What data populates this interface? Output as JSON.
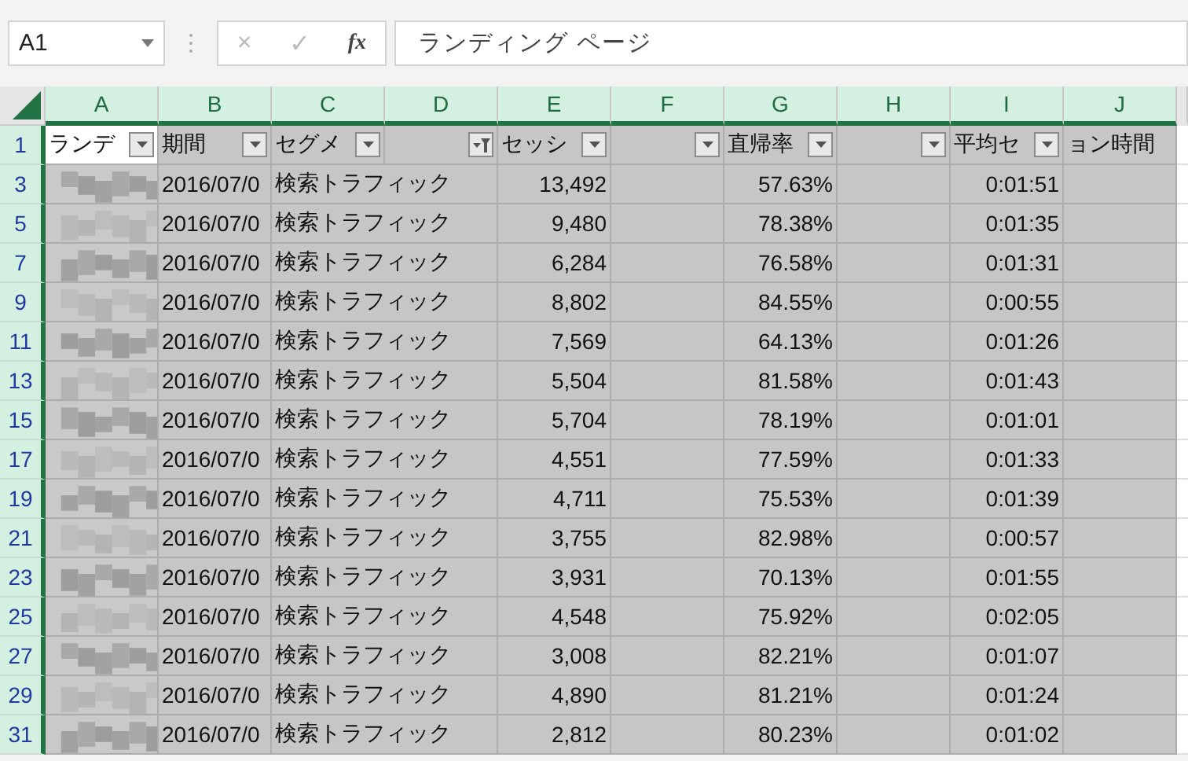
{
  "name_box": {
    "value": "A1"
  },
  "formula_bar": {
    "cancel": "×",
    "enter": "✓",
    "function": "fx",
    "value": "ランディング ページ"
  },
  "columns": [
    {
      "letter": "A",
      "selected": true
    },
    {
      "letter": "B",
      "selected": true
    },
    {
      "letter": "C",
      "selected": true
    },
    {
      "letter": "D",
      "selected": true
    },
    {
      "letter": "E",
      "selected": true
    },
    {
      "letter": "F",
      "selected": true
    },
    {
      "letter": "G",
      "selected": true
    },
    {
      "letter": "H",
      "selected": true
    },
    {
      "letter": "I",
      "selected": true
    },
    {
      "letter": "J",
      "selected": true
    }
  ],
  "header_row": {
    "number": "1",
    "cells": [
      {
        "text": "ランデ",
        "filter_button": true,
        "filter_applied": false
      },
      {
        "text": "期間",
        "filter_button": true,
        "filter_applied": false
      },
      {
        "text": "セグメ",
        "filter_button": true,
        "filter_applied": false
      },
      {
        "filter_button": true,
        "filter_applied": true
      },
      {
        "text": "セッシ",
        "filter_button": true,
        "filter_applied": false
      },
      {
        "filter_button": true,
        "filter_applied": false
      },
      {
        "text": "直帰率",
        "filter_button": true,
        "filter_applied": false
      },
      {
        "filter_button": true,
        "filter_applied": false
      },
      {
        "text": "平均セ",
        "filter_button": true,
        "filter_applied": false
      },
      {
        "text": "ョン時間",
        "filter_button": false
      }
    ]
  },
  "rows": [
    {
      "number": "3",
      "period": "2016/07/0",
      "segment": "検索トラフィック",
      "sessions": "13,492",
      "bounce_rate": "57.63%",
      "avg_duration": "0:01:51"
    },
    {
      "number": "5",
      "period": "2016/07/0",
      "segment": "検索トラフィック",
      "sessions": "9,480",
      "bounce_rate": "78.38%",
      "avg_duration": "0:01:35"
    },
    {
      "number": "7",
      "period": "2016/07/0",
      "segment": "検索トラフィック",
      "sessions": "6,284",
      "bounce_rate": "76.58%",
      "avg_duration": "0:01:31"
    },
    {
      "number": "9",
      "period": "2016/07/0",
      "segment": "検索トラフィック",
      "sessions": "8,802",
      "bounce_rate": "84.55%",
      "avg_duration": "0:00:55"
    },
    {
      "number": "11",
      "period": "2016/07/0",
      "segment": "検索トラフィック",
      "sessions": "7,569",
      "bounce_rate": "64.13%",
      "avg_duration": "0:01:26"
    },
    {
      "number": "13",
      "period": "2016/07/0",
      "segment": "検索トラフィック",
      "sessions": "5,504",
      "bounce_rate": "81.58%",
      "avg_duration": "0:01:43"
    },
    {
      "number": "15",
      "period": "2016/07/0",
      "segment": "検索トラフィック",
      "sessions": "5,704",
      "bounce_rate": "78.19%",
      "avg_duration": "0:01:01"
    },
    {
      "number": "17",
      "period": "2016/07/0",
      "segment": "検索トラフィック",
      "sessions": "4,551",
      "bounce_rate": "77.59%",
      "avg_duration": "0:01:33"
    },
    {
      "number": "19",
      "period": "2016/07/0",
      "segment": "検索トラフィック",
      "sessions": "4,711",
      "bounce_rate": "75.53%",
      "avg_duration": "0:01:39"
    },
    {
      "number": "21",
      "period": "2016/07/0",
      "segment": "検索トラフィック",
      "sessions": "3,755",
      "bounce_rate": "82.98%",
      "avg_duration": "0:00:57"
    },
    {
      "number": "23",
      "period": "2016/07/0",
      "segment": "検索トラフィック",
      "sessions": "3,931",
      "bounce_rate": "70.13%",
      "avg_duration": "0:01:55"
    },
    {
      "number": "25",
      "period": "2016/07/0",
      "segment": "検索トラフィック",
      "sessions": "4,548",
      "bounce_rate": "75.92%",
      "avg_duration": "0:02:05"
    },
    {
      "number": "27",
      "period": "2016/07/0",
      "segment": "検索トラフィック",
      "sessions": "3,008",
      "bounce_rate": "82.21%",
      "avg_duration": "0:01:07"
    },
    {
      "number": "29",
      "period": "2016/07/0",
      "segment": "検索トラフィック",
      "sessions": "4,890",
      "bounce_rate": "81.21%",
      "avg_duration": "0:01:24"
    },
    {
      "number": "31",
      "period": "2016/07/0",
      "segment": "検索トラフィック",
      "sessions": "2,812",
      "bounce_rate": "80.23%",
      "avg_duration": "0:01:02"
    }
  ]
}
